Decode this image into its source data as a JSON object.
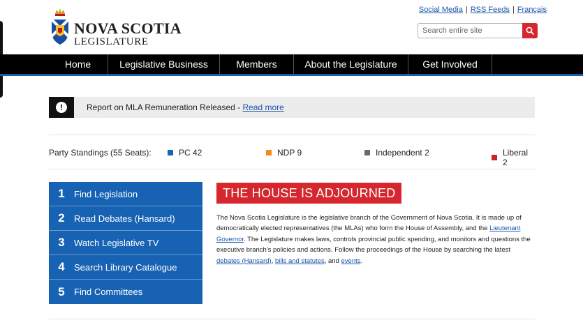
{
  "header": {
    "logo_line1": "NOVA SCOTIA",
    "logo_line2": "LEGISLATURE",
    "top_links": [
      "Social Media",
      "RSS Feeds",
      "Français"
    ],
    "search_placeholder": "Search entire site"
  },
  "nav": {
    "items": [
      "Home",
      "Legislative Business",
      "Members",
      "About the Legislature",
      "Get Involved"
    ]
  },
  "alert": {
    "text": "Report on MLA Remuneration Released - ",
    "link": "Read more"
  },
  "standings": {
    "label": "Party Standings (55 Seats):",
    "parties": [
      {
        "name": "PC 42",
        "color": "#1a64b8"
      },
      {
        "name": "NDP 9",
        "color": "#f08c1e"
      },
      {
        "name": "Independent 2",
        "color": "#6a6a6a"
      },
      {
        "name": "Liberal 2",
        "color": "#cc2128"
      }
    ]
  },
  "quick_links": [
    {
      "num": "1",
      "label": "Find Legislation"
    },
    {
      "num": "2",
      "label": "Read Debates (Hansard)"
    },
    {
      "num": "3",
      "label": "Watch Legislative TV"
    },
    {
      "num": "4",
      "label": "Search Library Catalogue"
    },
    {
      "num": "5",
      "label": "Find Committees"
    }
  ],
  "house": {
    "title": "THE HOUSE IS ADJOURNED",
    "p1": "The Nova Scotia Legislature is the legislative branch of the Government of Nova Scotia. It is made up of democratically elected representatives (the MLAs) who form the House of Assembly, and the ",
    "link_governor": "Lieutenant Governor",
    "p2": ". The Legislature makes laws, controls provincial public spending, and monitors and questions the executive branch's policies and actions. Follow the proceedings of the House by searching the latest ",
    "link_debates": "debates (Hansard)",
    "p3": ", ",
    "link_bills": "bills and statutes",
    "p4": ", and ",
    "link_events": "events",
    "p5": "."
  },
  "colors": {
    "nav_bg": "#000000",
    "nav_underline": "#1a5ea8",
    "accent_red": "#d6272e",
    "quicklink_blue": "#1762b3",
    "link": "#1a55a8"
  }
}
